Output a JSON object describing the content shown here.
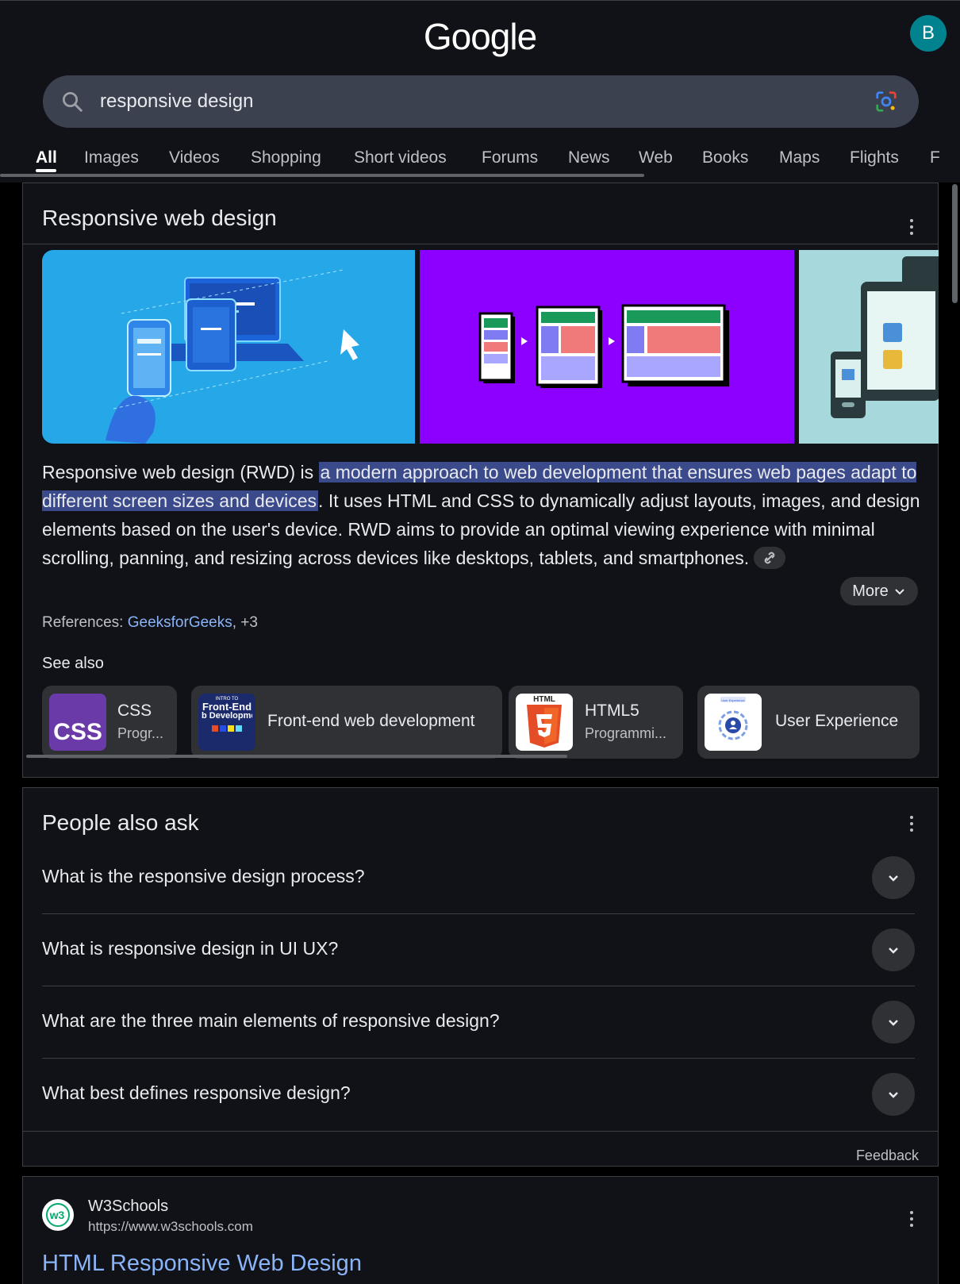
{
  "header": {
    "logo": "Google",
    "avatar_letter": "B",
    "search_query": "responsive design",
    "tabs": [
      "All",
      "Images",
      "Videos",
      "Shopping",
      "Short videos",
      "Forums",
      "News",
      "Web",
      "Books",
      "Maps",
      "Flights",
      "F"
    ]
  },
  "knowledge_panel": {
    "title": "Responsive web design",
    "description_pre": "Responsive web design (RWD) is ",
    "description_highlight": "a modern approach to web development that ensures web pages adapt to different screen sizes and devices",
    "description_post": ". It uses HTML and CSS to dynamically adjust layouts, images, and design elements based on the user's device. RWD aims to provide an optimal viewing experience with minimal scrolling, panning, and resizing across devices like desktops, tablets, and smartphones.",
    "more_label": "More",
    "references_label": "References: ",
    "references_link": "GeeksforGeeks",
    "references_more": ", +3",
    "see_also_label": "See also",
    "see_also": [
      {
        "title": "CSS",
        "subtitle": "Progr...",
        "icon": "css-logo",
        "image_text": "CSS"
      },
      {
        "title": "Front-end web development",
        "subtitle": "",
        "icon": "frontend-book-cover",
        "image_text_1": "INTRO TO",
        "image_text_2": "Front-End",
        "image_text_3": "b Developme"
      },
      {
        "title": "HTML5",
        "subtitle": "Programmi...",
        "icon": "html5-logo",
        "image_text": "HTML"
      },
      {
        "title": "User Experience",
        "subtitle": "",
        "icon": "user-experience-diagram",
        "image_text": "User Experience"
      }
    ]
  },
  "people_also_ask": {
    "title": "People also ask",
    "questions": [
      "What is the responsive design process?",
      "What is responsive design in UI UX?",
      "What are the three main elements of responsive design?",
      "What best defines responsive design?"
    ],
    "feedback_label": "Feedback"
  },
  "result": {
    "site_name": "W3Schools",
    "url": "https://www.w3schools.com",
    "title": "HTML Responsive Web Design",
    "icon_text": "w3"
  },
  "colors": {
    "background": "#101218",
    "link": "#8ab4f8",
    "highlight": "#3b4a8b",
    "avatar": "#00838f"
  }
}
